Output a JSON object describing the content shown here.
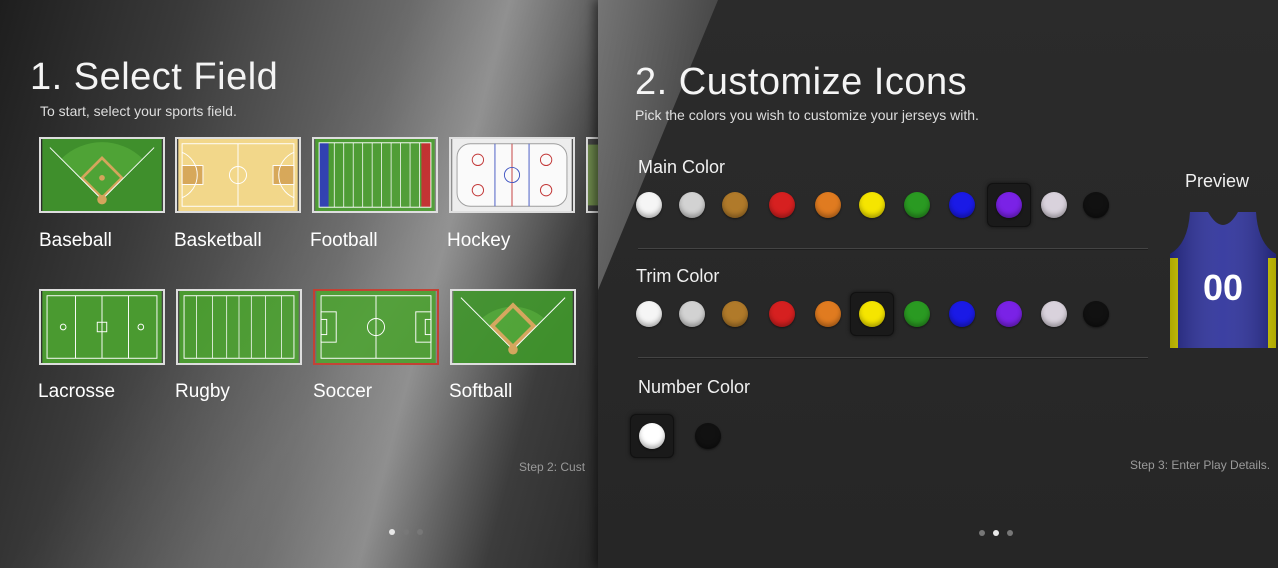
{
  "left_panel": {
    "title": "1. Select Field",
    "subtitle": "To start, select your sports field.",
    "fields": [
      {
        "label": "Baseball",
        "selected": false
      },
      {
        "label": "Basketball",
        "selected": false
      },
      {
        "label": "Football",
        "selected": false
      },
      {
        "label": "Hockey",
        "selected": false
      },
      {
        "label": "Lacrosse",
        "selected": false
      },
      {
        "label": "Rugby",
        "selected": false
      },
      {
        "label": "Soccer",
        "selected": true
      },
      {
        "label": "Softball",
        "selected": false
      }
    ],
    "step_hint": "Step 2: Cust",
    "pagination": {
      "count": 3,
      "active_index": 0
    }
  },
  "right_panel": {
    "title": "2. Customize Icons",
    "subtitle": "Pick the colors you wish to customize your jerseys with.",
    "main_color": {
      "label": "Main Color",
      "swatches": [
        "#f5f5f5",
        "#d2d2d2",
        "#b07a2a",
        "#d62020",
        "#e07b20",
        "#f5e500",
        "#2a9a22",
        "#1a1ae6",
        "#7a22e6",
        "#d9d2dc",
        "#111111"
      ],
      "selected_index": 8
    },
    "trim_color": {
      "label": "Trim Color",
      "swatches": [
        "#f5f5f5",
        "#d2d2d2",
        "#b07a2a",
        "#d62020",
        "#e07b20",
        "#f5e500",
        "#2a9a22",
        "#1a1ae6",
        "#7a22e6",
        "#d9d2dc",
        "#111111"
      ],
      "selected_index": 5
    },
    "number_color": {
      "label": "Number Color",
      "swatches": [
        "#ffffff",
        "#111111"
      ],
      "selected_index": 0
    },
    "preview": {
      "label": "Preview",
      "jersey_number": "00",
      "jersey_main_color": "#2b2f9a",
      "jersey_trim_color": "#e8e000"
    },
    "step_hint": "Step 3: Enter Play Details.",
    "pagination": {
      "count": 3,
      "active_index": 1
    }
  }
}
